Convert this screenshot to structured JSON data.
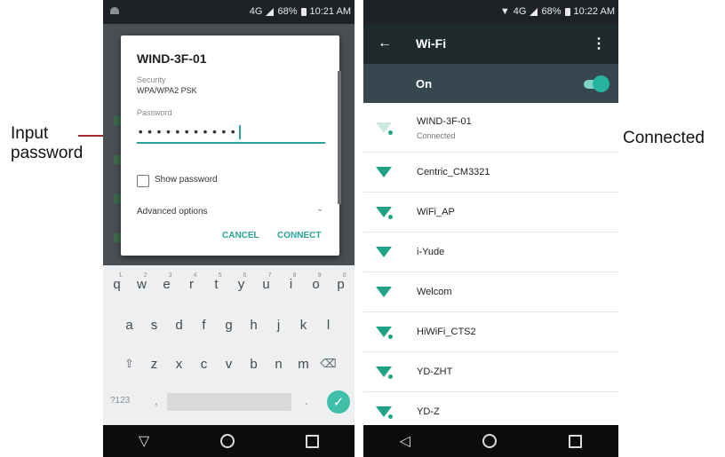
{
  "annotations": {
    "input_password": [
      "Input",
      "password"
    ],
    "connected": "Connected"
  },
  "left_phone": {
    "status": {
      "network": "4G",
      "battery": "68%",
      "time": "10:21 AM"
    },
    "dialog": {
      "title": "WIND-3F-01",
      "security_label": "Security",
      "security_value": "WPA/WPA2 PSK",
      "password_label": "Password",
      "password_value": "•••••••••••",
      "show_password_label": "Show password",
      "advanced_label": "Advanced options",
      "cancel_label": "CANCEL",
      "connect_label": "CONNECT"
    },
    "keyboard": {
      "row1": [
        {
          "k": "q",
          "n": "1"
        },
        {
          "k": "w",
          "n": "2"
        },
        {
          "k": "e",
          "n": "3"
        },
        {
          "k": "r",
          "n": "4"
        },
        {
          "k": "t",
          "n": "5"
        },
        {
          "k": "y",
          "n": "6"
        },
        {
          "k": "u",
          "n": "7"
        },
        {
          "k": "i",
          "n": "8"
        },
        {
          "k": "o",
          "n": "9"
        },
        {
          "k": "p",
          "n": "0"
        }
      ],
      "row2": [
        "a",
        "s",
        "d",
        "f",
        "g",
        "h",
        "j",
        "k",
        "l"
      ],
      "row3": [
        "z",
        "x",
        "c",
        "v",
        "b",
        "n",
        "m"
      ],
      "symbols_label": "?123",
      "comma": ",",
      "period": "."
    }
  },
  "right_phone": {
    "status": {
      "network": "4G",
      "battery": "68%",
      "time": "10:22 AM"
    },
    "title": "Wi-Fi",
    "toggle_label": "On",
    "toggle_on": true,
    "networks": [
      {
        "name": "WIND-3F-01",
        "status": "Connected",
        "locked": true,
        "faint": true
      },
      {
        "name": "Centric_CM3321",
        "status": "",
        "locked": false,
        "faint": false
      },
      {
        "name": "WiFi_AP",
        "status": "",
        "locked": true,
        "faint": false
      },
      {
        "name": "i-Yude",
        "status": "",
        "locked": false,
        "faint": false
      },
      {
        "name": "Welcom",
        "status": "",
        "locked": false,
        "faint": false
      },
      {
        "name": "HiWiFi_CTS2",
        "status": "",
        "locked": true,
        "faint": false
      },
      {
        "name": "YD-ZHT",
        "status": "",
        "locked": true,
        "faint": false
      },
      {
        "name": "YD-Z",
        "status": "",
        "locked": true,
        "faint": false
      }
    ]
  },
  "colors": {
    "accent": "#27a59b",
    "wifi_green": "#1fa286",
    "appbar": "#1f2a2d",
    "toggle_bar": "#37474f",
    "annotation_line": "#9e2a2a"
  }
}
